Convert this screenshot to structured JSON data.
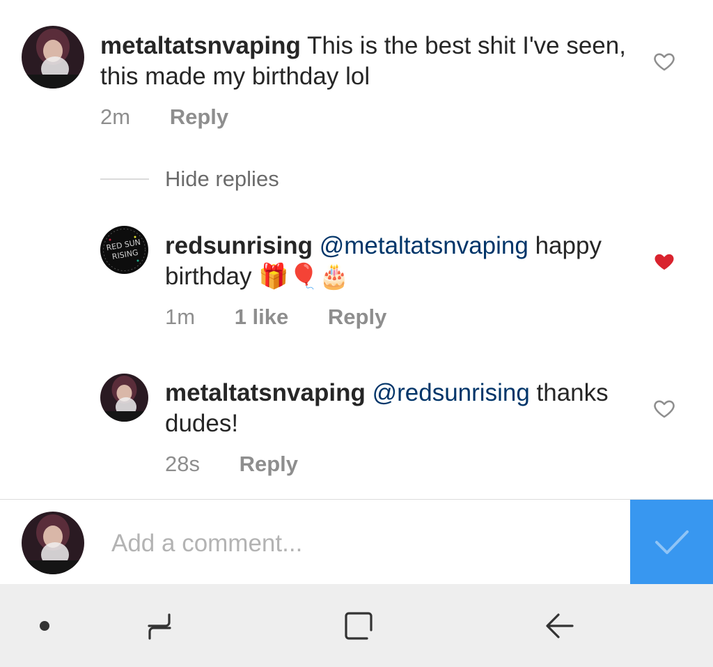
{
  "comments": [
    {
      "username": "metaltatsnvaping",
      "text": " This is the best shit I've seen, this made my birthday lol",
      "time": "2m",
      "reply_label": "Reply",
      "liked": false
    },
    {
      "username": "redsunrising",
      "mention": "@metaltatsnvaping",
      "text": " happy birthday 🎁🎈🎂",
      "time": "1m",
      "likes": "1 like",
      "reply_label": "Reply",
      "liked": true
    },
    {
      "username": "metaltatsnvaping",
      "mention": "@redsunrising",
      "text": " thanks dudes!",
      "time": "28s",
      "reply_label": "Reply",
      "liked": false
    }
  ],
  "hide_replies_label": "Hide replies",
  "composer": {
    "placeholder": "Add a comment..."
  },
  "colors": {
    "liked_heart": "#d9232e",
    "post_button": "#3897f0",
    "mention": "#003569",
    "muted_text": "#8e8e8e"
  },
  "icons": {
    "like": "heart-outline-icon",
    "liked": "heart-filled-icon",
    "post": "checkmark-icon",
    "nav": [
      "dot-icon",
      "recent-apps-icon",
      "home-square-icon",
      "back-arrow-icon"
    ]
  }
}
